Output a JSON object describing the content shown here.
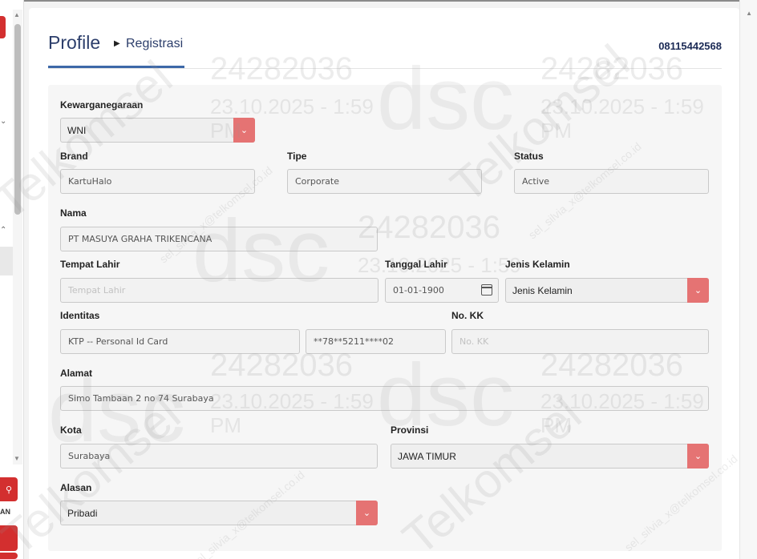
{
  "header": {
    "title": "Profile",
    "breadcrumb": "Registrasi",
    "msisdn": "08115442568"
  },
  "form": {
    "kewarganegaraan": {
      "label": "Kewarganegaraan",
      "value": "WNI"
    },
    "brand": {
      "label": "Brand",
      "value": "KartuHalo"
    },
    "tipe": {
      "label": "Tipe",
      "value": "Corporate"
    },
    "status": {
      "label": "Status",
      "value": "Active"
    },
    "nama": {
      "label": "Nama",
      "value": "PT MASUYA GRAHA TRIKENCANA"
    },
    "tempat_lahir": {
      "label": "Tempat Lahir",
      "placeholder": "Tempat Lahir"
    },
    "tanggal_lahir": {
      "label": "Tanggal Lahir",
      "value": "01-01-1900"
    },
    "jenis_kelamin": {
      "label": "Jenis Kelamin",
      "value": "Jenis Kelamin"
    },
    "identitas": {
      "label": "Identitas",
      "type_value": "KTP -- Personal Id Card",
      "number_value": "**78**5211****02"
    },
    "no_kk": {
      "label": "No. KK",
      "placeholder": "No. KK"
    },
    "alamat": {
      "label": "Alamat",
      "value": "Simo Tambaan 2 no 74 Surabaya"
    },
    "kota": {
      "label": "Kota",
      "value": "Surabaya"
    },
    "provinsi": {
      "label": "Provinsi",
      "value": "JAWA TIMUR"
    },
    "alasan": {
      "label": "Alasan",
      "value": "Pribadi"
    }
  },
  "left_panel": {
    "partial_label": "AN"
  },
  "watermark": {
    "id": "24282036",
    "datetime": "23.10.2025 - 1:59",
    "ampm": "PM",
    "brand": "Telkomsel",
    "logo": "dsc",
    "email": "sel_silvia_x@telkomsel.co.id"
  },
  "colors": {
    "accent": "#e57373",
    "title": "#2c3e6b",
    "underline": "#3d68a8",
    "red": "#d32f2f"
  },
  "icons": {
    "dropdown": "chevron-down-icon",
    "calendar": "calendar-icon",
    "search": "search-icon"
  }
}
